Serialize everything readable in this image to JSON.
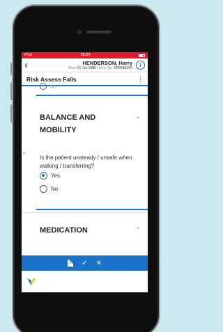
{
  "status_bar": {
    "carrier": "iPod",
    "time": "15:37"
  },
  "patient": {
    "back_glyph": "‹",
    "name": "HENDERSON, Harry",
    "born_label": "Born",
    "dob": "01-Jul-1980",
    "hosp_label": "Hosp. No.",
    "hosp_no": "800086150",
    "info_glyph": "i"
  },
  "form": {
    "title": "Risk Assess Falls",
    "menu_glyph": "⋮",
    "prev_option_label": "No"
  },
  "sections": {
    "balance": {
      "title_line1": "BALANCE AND",
      "title_line2": "MOBILITY",
      "question": "Is the patient unsteady / unsafe when walking / transferring?",
      "options": [
        {
          "label": "Yes",
          "selected": true
        },
        {
          "label": "No",
          "selected": false
        }
      ]
    },
    "medication": {
      "title": "MEDICATION"
    }
  },
  "glyphs": {
    "chevron_up": "⌃",
    "side_chevron": "›",
    "check": "✓",
    "close": "✕"
  },
  "colors": {
    "accent": "#1a73c8",
    "status_bar": "#e8192c"
  }
}
